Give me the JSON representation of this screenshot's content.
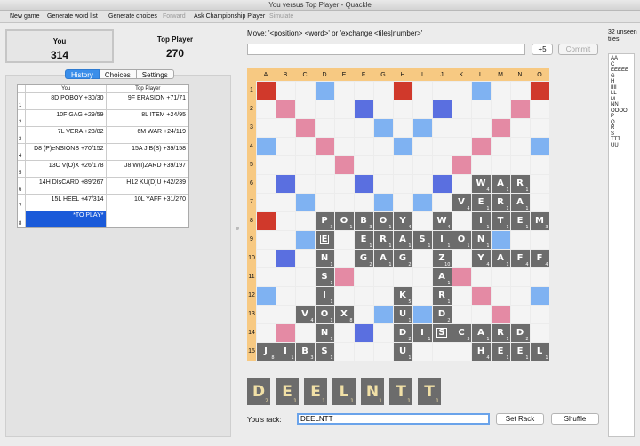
{
  "window": {
    "title": "You versus Top Player - Quackle"
  },
  "toolbar": [
    {
      "label": "New game",
      "enabled": true
    },
    {
      "label": "Generate word list",
      "enabled": true
    },
    {
      "label": "Generate choices",
      "enabled": true
    },
    {
      "label": "Forward",
      "enabled": false
    },
    {
      "label": "Ask Championship Player",
      "enabled": true
    },
    {
      "label": "Simulate",
      "enabled": false
    }
  ],
  "scores": {
    "you": {
      "name": "You",
      "score": "314"
    },
    "opponent": {
      "name": "Top Player",
      "score": "270"
    }
  },
  "tabs": [
    {
      "label": "History",
      "active": true
    },
    {
      "label": "Choices",
      "active": false
    },
    {
      "label": "Settings",
      "active": false
    }
  ],
  "history": {
    "headers": [
      "You",
      "Top Player"
    ],
    "rows": [
      {
        "num": "1",
        "you": "8D POBOY   +30/30",
        "top": "9F ERASION   +71/71"
      },
      {
        "num": "2",
        "you": "10F GAG   +29/59",
        "top": "8L ITEM   +24/95"
      },
      {
        "num": "3",
        "you": "7L VERA   +23/82",
        "top": "6M WAR   +24/119"
      },
      {
        "num": "4",
        "you": "D8 (P)eNSIONS   +70/152",
        "top": "15A JIB(S)   +39/158"
      },
      {
        "num": "5",
        "you": "13C V(O)X   +26/178",
        "top": "J8 W(I)ZARD   +39/197"
      },
      {
        "num": "6",
        "you": "14H DIsCARD   +89/267",
        "top": "H12 KU(D)U   +42/239"
      },
      {
        "num": "7",
        "you": "15L HEEL   +47/314",
        "top": "10L YAFF   +31/270"
      },
      {
        "num": "8",
        "you": "*TO PLAY*",
        "top": ""
      }
    ]
  },
  "move": {
    "label": "Move: '<position> <word>' or 'exchange <tiles|number>'",
    "value": "",
    "plus5_label": "+5",
    "commit_label": "Commit"
  },
  "unseen": {
    "title": "32 unseen tiles",
    "rows": [
      "AA",
      "C",
      "EEEEE",
      "G",
      "H",
      "IIII",
      "LL",
      "M",
      "NN",
      "OOOO",
      "P",
      "Q",
      "R",
      "S",
      "TTT",
      "UU"
    ]
  },
  "board": {
    "columns": [
      "A",
      "B",
      "C",
      "D",
      "E",
      "F",
      "G",
      "H",
      "I",
      "J",
      "K",
      "L",
      "M",
      "N",
      "O"
    ],
    "rows": [
      "1",
      "2",
      "3",
      "4",
      "5",
      "6",
      "7",
      "8",
      "9",
      "10",
      "11",
      "12",
      "13",
      "14",
      "15"
    ],
    "colors": {
      "label": "#f7c982",
      "tw": "#d0392b",
      "dw": "#e48aa4",
      "tl": "#5a6fe0",
      "dl": "#7fb2f2",
      "empty": "#f4f4f4",
      "tile": "#6c6c6c",
      "rack_letter": "#f1e0a6"
    },
    "tiles": [
      {
        "r": 6,
        "c": 12,
        "l": "W",
        "p": "4"
      },
      {
        "r": 6,
        "c": 13,
        "l": "A",
        "p": "1"
      },
      {
        "r": 6,
        "c": 14,
        "l": "R",
        "p": "1"
      },
      {
        "r": 7,
        "c": 11,
        "l": "V",
        "p": "4"
      },
      {
        "r": 7,
        "c": 12,
        "l": "E",
        "p": "1"
      },
      {
        "r": 7,
        "c": 13,
        "l": "R",
        "p": "1"
      },
      {
        "r": 7,
        "c": 14,
        "l": "A",
        "p": "1"
      },
      {
        "r": 8,
        "c": 4,
        "l": "P",
        "p": "3"
      },
      {
        "r": 8,
        "c": 5,
        "l": "O",
        "p": "1"
      },
      {
        "r": 8,
        "c": 6,
        "l": "B",
        "p": "3"
      },
      {
        "r": 8,
        "c": 7,
        "l": "O",
        "p": "1"
      },
      {
        "r": 8,
        "c": 8,
        "l": "Y",
        "p": "4"
      },
      {
        "r": 8,
        "c": 10,
        "l": "W",
        "p": "4"
      },
      {
        "r": 8,
        "c": 12,
        "l": "I",
        "p": "1"
      },
      {
        "r": 8,
        "c": 13,
        "l": "T",
        "p": "1"
      },
      {
        "r": 8,
        "c": 14,
        "l": "E",
        "p": "1"
      },
      {
        "r": 8,
        "c": 15,
        "l": "M",
        "p": "3"
      },
      {
        "r": 9,
        "c": 4,
        "l": "E",
        "p": "",
        "blank": true
      },
      {
        "r": 9,
        "c": 6,
        "l": "E",
        "p": "1"
      },
      {
        "r": 9,
        "c": 7,
        "l": "R",
        "p": "1"
      },
      {
        "r": 9,
        "c": 8,
        "l": "A",
        "p": "1"
      },
      {
        "r": 9,
        "c": 9,
        "l": "S",
        "p": "1"
      },
      {
        "r": 9,
        "c": 10,
        "l": "I",
        "p": "1"
      },
      {
        "r": 9,
        "c": 11,
        "l": "O",
        "p": "1"
      },
      {
        "r": 9,
        "c": 12,
        "l": "N",
        "p": "1"
      },
      {
        "r": 10,
        "c": 4,
        "l": "N",
        "p": "1"
      },
      {
        "r": 10,
        "c": 6,
        "l": "G",
        "p": "2"
      },
      {
        "r": 10,
        "c": 7,
        "l": "A",
        "p": "1"
      },
      {
        "r": 10,
        "c": 8,
        "l": "G",
        "p": "2"
      },
      {
        "r": 10,
        "c": 10,
        "l": "Z",
        "p": "10"
      },
      {
        "r": 10,
        "c": 12,
        "l": "Y",
        "p": "4"
      },
      {
        "r": 10,
        "c": 13,
        "l": "A",
        "p": "1"
      },
      {
        "r": 10,
        "c": 14,
        "l": "F",
        "p": "4"
      },
      {
        "r": 10,
        "c": 15,
        "l": "F",
        "p": "4"
      },
      {
        "r": 11,
        "c": 4,
        "l": "S",
        "p": "1"
      },
      {
        "r": 11,
        "c": 10,
        "l": "A",
        "p": "1"
      },
      {
        "r": 12,
        "c": 4,
        "l": "I",
        "p": "1"
      },
      {
        "r": 12,
        "c": 8,
        "l": "K",
        "p": "5"
      },
      {
        "r": 12,
        "c": 10,
        "l": "R",
        "p": "1"
      },
      {
        "r": 13,
        "c": 3,
        "l": "V",
        "p": "4"
      },
      {
        "r": 13,
        "c": 4,
        "l": "O",
        "p": "1"
      },
      {
        "r": 13,
        "c": 5,
        "l": "X",
        "p": "8"
      },
      {
        "r": 13,
        "c": 8,
        "l": "U",
        "p": "1"
      },
      {
        "r": 13,
        "c": 10,
        "l": "D",
        "p": "2"
      },
      {
        "r": 14,
        "c": 4,
        "l": "N",
        "p": "1"
      },
      {
        "r": 14,
        "c": 8,
        "l": "D",
        "p": "2"
      },
      {
        "r": 14,
        "c": 9,
        "l": "I",
        "p": "1"
      },
      {
        "r": 14,
        "c": 10,
        "l": "S",
        "p": "",
        "blank": true
      },
      {
        "r": 14,
        "c": 11,
        "l": "C",
        "p": "3"
      },
      {
        "r": 14,
        "c": 12,
        "l": "A",
        "p": "1"
      },
      {
        "r": 14,
        "c": 13,
        "l": "R",
        "p": "1"
      },
      {
        "r": 14,
        "c": 14,
        "l": "D",
        "p": "2"
      },
      {
        "r": 15,
        "c": 1,
        "l": "J",
        "p": "8"
      },
      {
        "r": 15,
        "c": 2,
        "l": "I",
        "p": "1"
      },
      {
        "r": 15,
        "c": 3,
        "l": "B",
        "p": "3"
      },
      {
        "r": 15,
        "c": 4,
        "l": "S",
        "p": "1"
      },
      {
        "r": 15,
        "c": 8,
        "l": "U",
        "p": "1"
      },
      {
        "r": 15,
        "c": 12,
        "l": "H",
        "p": "4"
      },
      {
        "r": 15,
        "c": 13,
        "l": "E",
        "p": "1"
      },
      {
        "r": 15,
        "c": 14,
        "l": "E",
        "p": "1"
      },
      {
        "r": 15,
        "c": 15,
        "l": "L",
        "p": "1"
      }
    ]
  },
  "rack": {
    "tiles": [
      {
        "l": "D",
        "p": "2"
      },
      {
        "l": "E",
        "p": "1"
      },
      {
        "l": "E",
        "p": "1"
      },
      {
        "l": "L",
        "p": "1"
      },
      {
        "l": "N",
        "p": "1"
      },
      {
        "l": "T",
        "p": "1"
      },
      {
        "l": "T",
        "p": "1"
      }
    ],
    "label": "You's rack:",
    "value": "DEELNTT",
    "set_rack_label": "Set Rack",
    "shuffle_label": "Shuffle"
  }
}
